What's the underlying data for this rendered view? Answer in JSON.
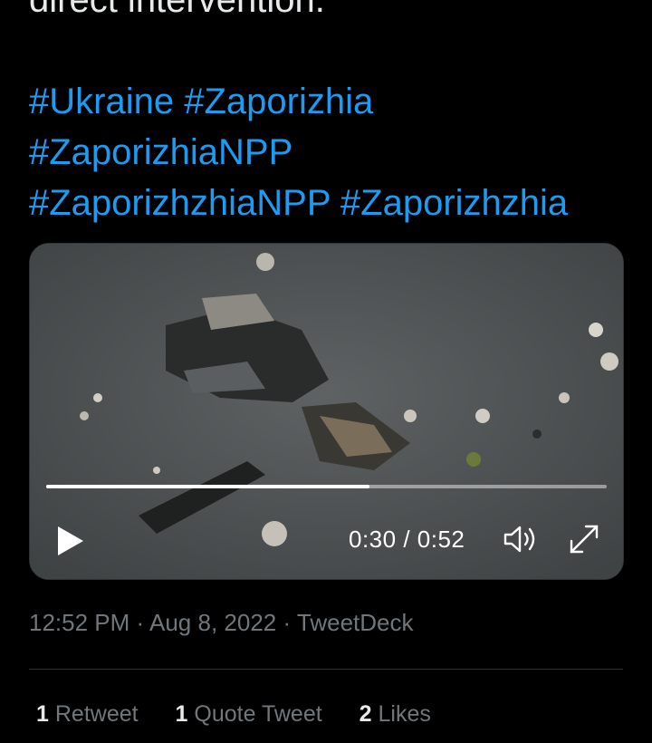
{
  "tweet": {
    "text_tail": "direct intervention.",
    "hashtag_lines": [
      [
        "#Ukraine",
        "#Zaporizhia"
      ],
      [
        "#ZaporizhiaNPP"
      ],
      [
        "#ZaporizhzhiaNPP",
        "#Zaporizhzhia"
      ]
    ]
  },
  "video": {
    "current_time": "0:30",
    "duration": "0:52",
    "time_display": "0:30 / 0:52",
    "progress": 0.577,
    "icons": {
      "play": "play-icon",
      "volume": "volume-icon",
      "fullscreen": "fullscreen-icon"
    }
  },
  "meta": {
    "time": "12:52 PM",
    "sep1": "·",
    "date": "Aug 8, 2022",
    "sep2": "·",
    "source": "TweetDeck"
  },
  "stats": {
    "retweets": {
      "count": "1",
      "label": "Retweet"
    },
    "quotes": {
      "count": "1",
      "label": "Quote Tweet"
    },
    "likes": {
      "count": "2",
      "label": "Likes"
    }
  },
  "colors": {
    "background": "#000000",
    "text": "#e7e9ea",
    "link": "#1d9bf0",
    "muted": "#71767b",
    "divider": "#2f3336"
  }
}
